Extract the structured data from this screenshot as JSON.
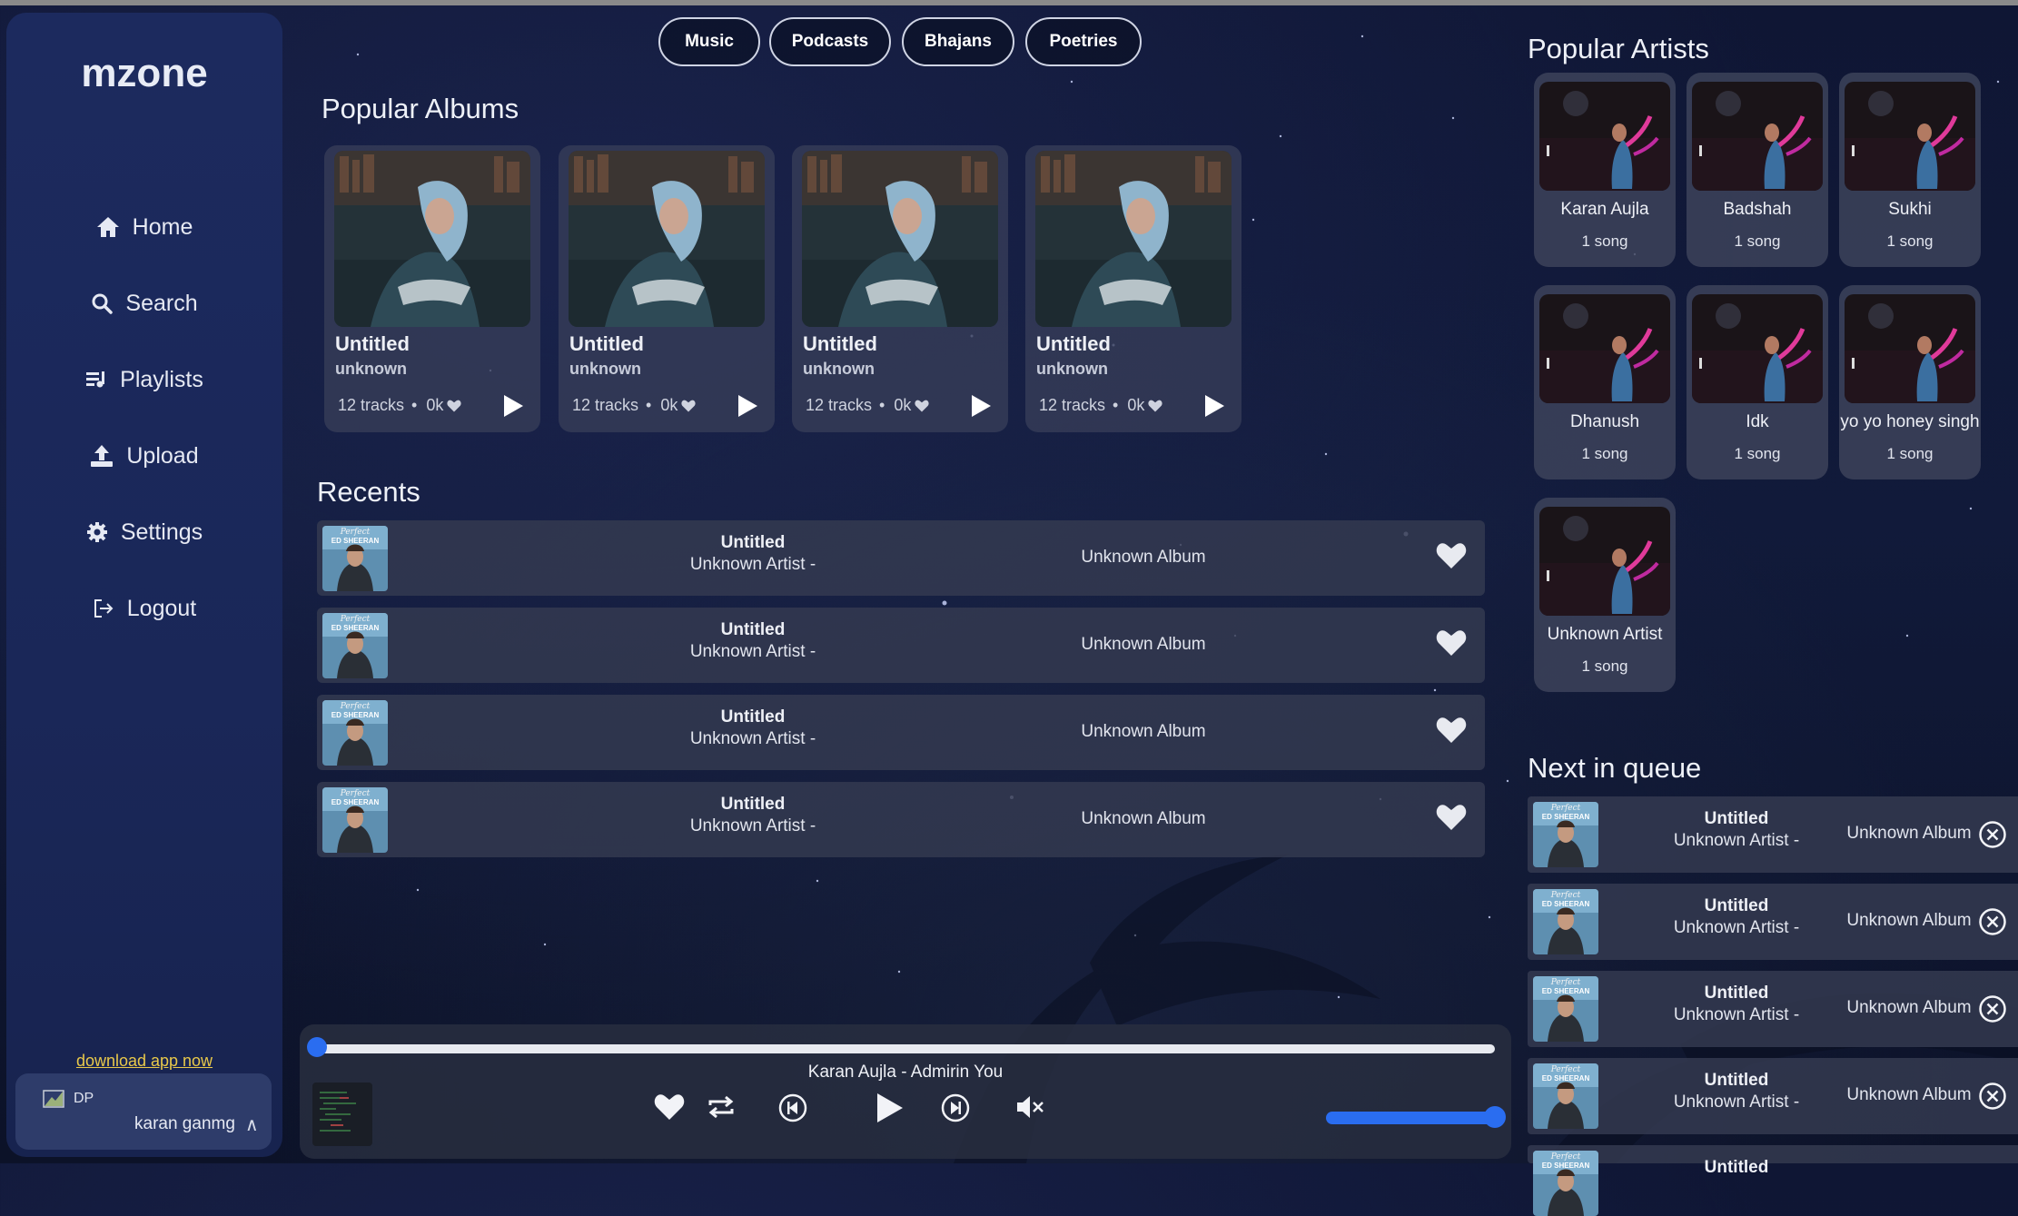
{
  "app": {
    "logo": "mzone"
  },
  "nav": [
    {
      "label": "Home",
      "icon": "home-icon"
    },
    {
      "label": "Search",
      "icon": "search-icon"
    },
    {
      "label": "Playlists",
      "icon": "playlist-icon"
    },
    {
      "label": "Upload",
      "icon": "upload-icon"
    },
    {
      "label": "Settings",
      "icon": "gear-icon"
    },
    {
      "label": "Logout",
      "icon": "logout-icon"
    }
  ],
  "download_link": "download app now",
  "user": {
    "dp_alt": "DP",
    "name": "karan ganmg"
  },
  "tabs": [
    "Music",
    "Podcasts",
    "Bhajans",
    "Poetries"
  ],
  "popular_albums": {
    "title": "Popular Albums",
    "items": [
      {
        "title": "Untitled",
        "artist": "unknown",
        "tracks": "12 tracks",
        "likes": "0k"
      },
      {
        "title": "Untitled",
        "artist": "unknown",
        "tracks": "12 tracks",
        "likes": "0k"
      },
      {
        "title": "Untitled",
        "artist": "unknown",
        "tracks": "12 tracks",
        "likes": "0k"
      },
      {
        "title": "Untitled",
        "artist": "unknown",
        "tracks": "12 tracks",
        "likes": "0k"
      }
    ]
  },
  "recents": {
    "title": "Recents",
    "items": [
      {
        "title": "Untitled",
        "artist": "Unknown Artist -",
        "album": "Unknown Album"
      },
      {
        "title": "Untitled",
        "artist": "Unknown Artist -",
        "album": "Unknown Album"
      },
      {
        "title": "Untitled",
        "artist": "Unknown Artist -",
        "album": "Unknown Album"
      },
      {
        "title": "Untitled",
        "artist": "Unknown Artist -",
        "album": "Unknown Album"
      }
    ]
  },
  "popular_artists": {
    "title": "Popular Artists",
    "items": [
      {
        "name": "Karan Aujla",
        "count": "1 song"
      },
      {
        "name": "Badshah",
        "count": "1 song"
      },
      {
        "name": "Sukhi",
        "count": "1 song"
      },
      {
        "name": "Dhanush",
        "count": "1 song"
      },
      {
        "name": "Idk",
        "count": "1 song"
      },
      {
        "name": "yo yo honey singh",
        "count": "1 song"
      },
      {
        "name": "Unknown Artist",
        "count": "1 song"
      }
    ]
  },
  "queue": {
    "title": "Next in queue",
    "items": [
      {
        "title": "Untitled",
        "artist": "Unknown Artist -",
        "album": "Unknown Album"
      },
      {
        "title": "Untitled",
        "artist": "Unknown Artist -",
        "album": "Unknown Album"
      },
      {
        "title": "Untitled",
        "artist": "Unknown Artist -",
        "album": "Unknown Album"
      },
      {
        "title": "Untitled",
        "artist": "Unknown Artist -",
        "album": "Unknown Album"
      },
      {
        "title": "Untitled",
        "artist": "",
        "album": ""
      }
    ]
  },
  "cover_text": {
    "line1": "Perfect",
    "line2": "ED SHEERAN"
  },
  "player": {
    "now_playing": "Karan Aujla - Admirin You",
    "progress": 0.0,
    "volume": 1.0,
    "controls": [
      "heart-icon",
      "repeat-icon",
      "previous-icon",
      "play-icon",
      "next-icon",
      "mute-icon"
    ]
  },
  "colors": {
    "accent": "#2a6df0",
    "sidebar": "#1c2a5e",
    "link": "#e9c94a"
  }
}
